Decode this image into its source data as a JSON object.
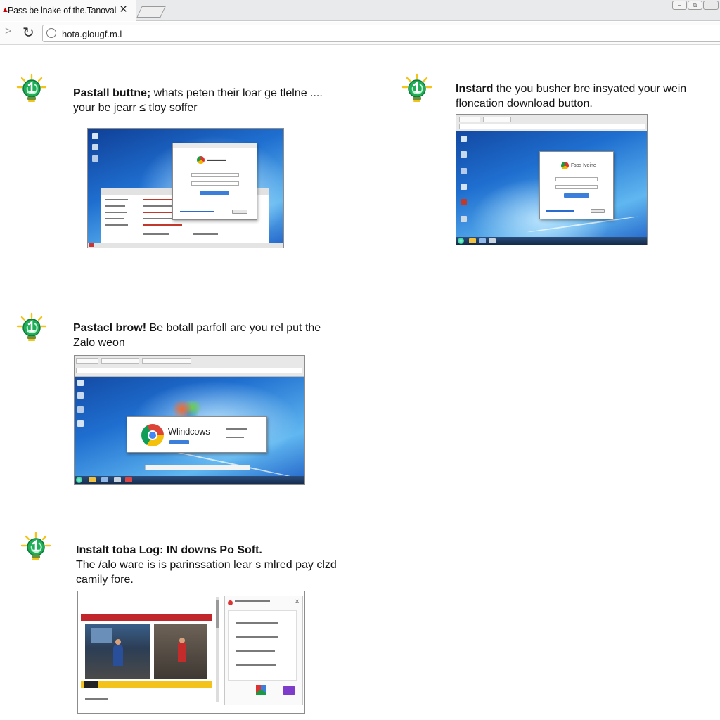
{
  "browser": {
    "tab_title": "Pass be lnake of the.Tanoval",
    "tab_warning_icon": "warning-triangle-icon",
    "tab_close_label": "×",
    "address": "hota.glougf.m.l",
    "window_controls": [
      "minimize-icon",
      "restore-icon"
    ]
  },
  "steps": [
    {
      "icon": "lightbulb-download-icon",
      "text_bold": "Pastall buttne;",
      "text_line1_rest": " whats peten their loar ge tlelne ....",
      "text_line2": "your be jearr ≤ tloy soffer"
    },
    {
      "icon": "lightbulb-download-icon",
      "text_bold": "Instard",
      "text_line1_rest": " the you busher bre insyated your wein",
      "text_line2": "floncation download button.",
      "dialog_title": "Fsos Ivoine"
    },
    {
      "icon": "lightbulb-download-icon",
      "text_bold": "Pastacl brow!",
      "text_line1_rest": " Be botall parfoll are you rel put the",
      "text_line2": "Zalo weon",
      "dialog_word": "Wlindcows"
    },
    {
      "icon": "lightbulb-download-icon",
      "text_bold": "Instalt toba Log: IN downs Po Soft.",
      "text_line1_rest": "",
      "text_line2": "The /alo ware is is parinssation lear s mlred pay clzd",
      "text_line3": "camily fore."
    }
  ],
  "colors": {
    "accent_green": "#1a9a43",
    "bulb_yellow": "#f2c418",
    "desktop_blue": "#1f6fd0"
  }
}
